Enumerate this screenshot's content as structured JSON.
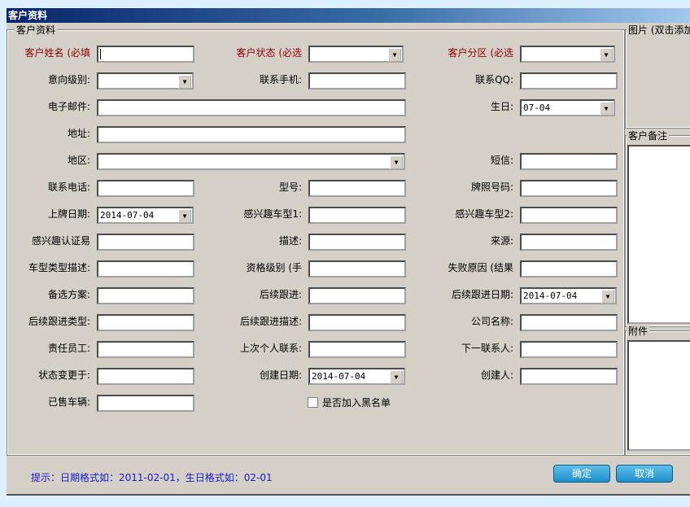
{
  "window": {
    "title": "客户资料"
  },
  "group_main": "客户资料",
  "group_picture": "图片 (双击添加",
  "group_notes": "客户备注",
  "group_attach": "附件",
  "fields": [
    {
      "label": "客户姓名 (必填",
      "value": ""
    },
    {
      "label": "客户状态 (必选",
      "value": ""
    },
    {
      "label": "客户分区 (必选",
      "value": ""
    },
    {
      "label": "意向级别:",
      "value": ""
    },
    {
      "label": "联系手机:",
      "value": ""
    },
    {
      "label": "联系QQ:",
      "value": ""
    },
    {
      "label": "电子邮件:",
      "value": ""
    },
    {
      "label": "生日:",
      "value": "07-04"
    },
    {
      "label": "地址:",
      "value": ""
    },
    {
      "label": "地区:",
      "value": ""
    },
    {
      "label": "短信:",
      "value": ""
    },
    {
      "label": "联系电话:",
      "value": ""
    },
    {
      "label": "型号:",
      "value": ""
    },
    {
      "label": "牌照号码:",
      "value": ""
    },
    {
      "label": "上牌日期:",
      "value": "2014-07-04"
    },
    {
      "label": "感兴趣车型1:",
      "value": ""
    },
    {
      "label": "感兴趣车型2:",
      "value": ""
    },
    {
      "label": "感兴趣认证易",
      "value": ""
    },
    {
      "label": "描述:",
      "value": ""
    },
    {
      "label": "来源:",
      "value": ""
    },
    {
      "label": "车型类型描述:",
      "value": ""
    },
    {
      "label": "资格级别 (手",
      "value": ""
    },
    {
      "label": "失败原因 (结果",
      "value": ""
    },
    {
      "label": "备选方案:",
      "value": ""
    },
    {
      "label": "后续跟进:",
      "value": ""
    },
    {
      "label": "后续跟进日期:",
      "value": "2014-07-04"
    },
    {
      "label": "后续跟进类型:",
      "value": ""
    },
    {
      "label": "后续跟进描述:",
      "value": ""
    },
    {
      "label": "公司名称:",
      "value": ""
    },
    {
      "label": "责任员工:",
      "value": ""
    },
    {
      "label": "上次个人联系:",
      "value": ""
    },
    {
      "label": "下一联系人:",
      "value": ""
    },
    {
      "label": "状态变更于:",
      "value": ""
    },
    {
      "label": "创建日期:",
      "value": "2014-07-04"
    },
    {
      "label": "创建人:",
      "value": ""
    },
    {
      "label": "已售车辆:",
      "value": ""
    }
  ],
  "blacklist": {
    "label": "是否加入黑名单",
    "checked": false
  },
  "hint": "提示：日期格式如：2011-02-01，生日格式如：02-01",
  "buttons": {
    "ok": "确定",
    "cancel": "取消"
  }
}
